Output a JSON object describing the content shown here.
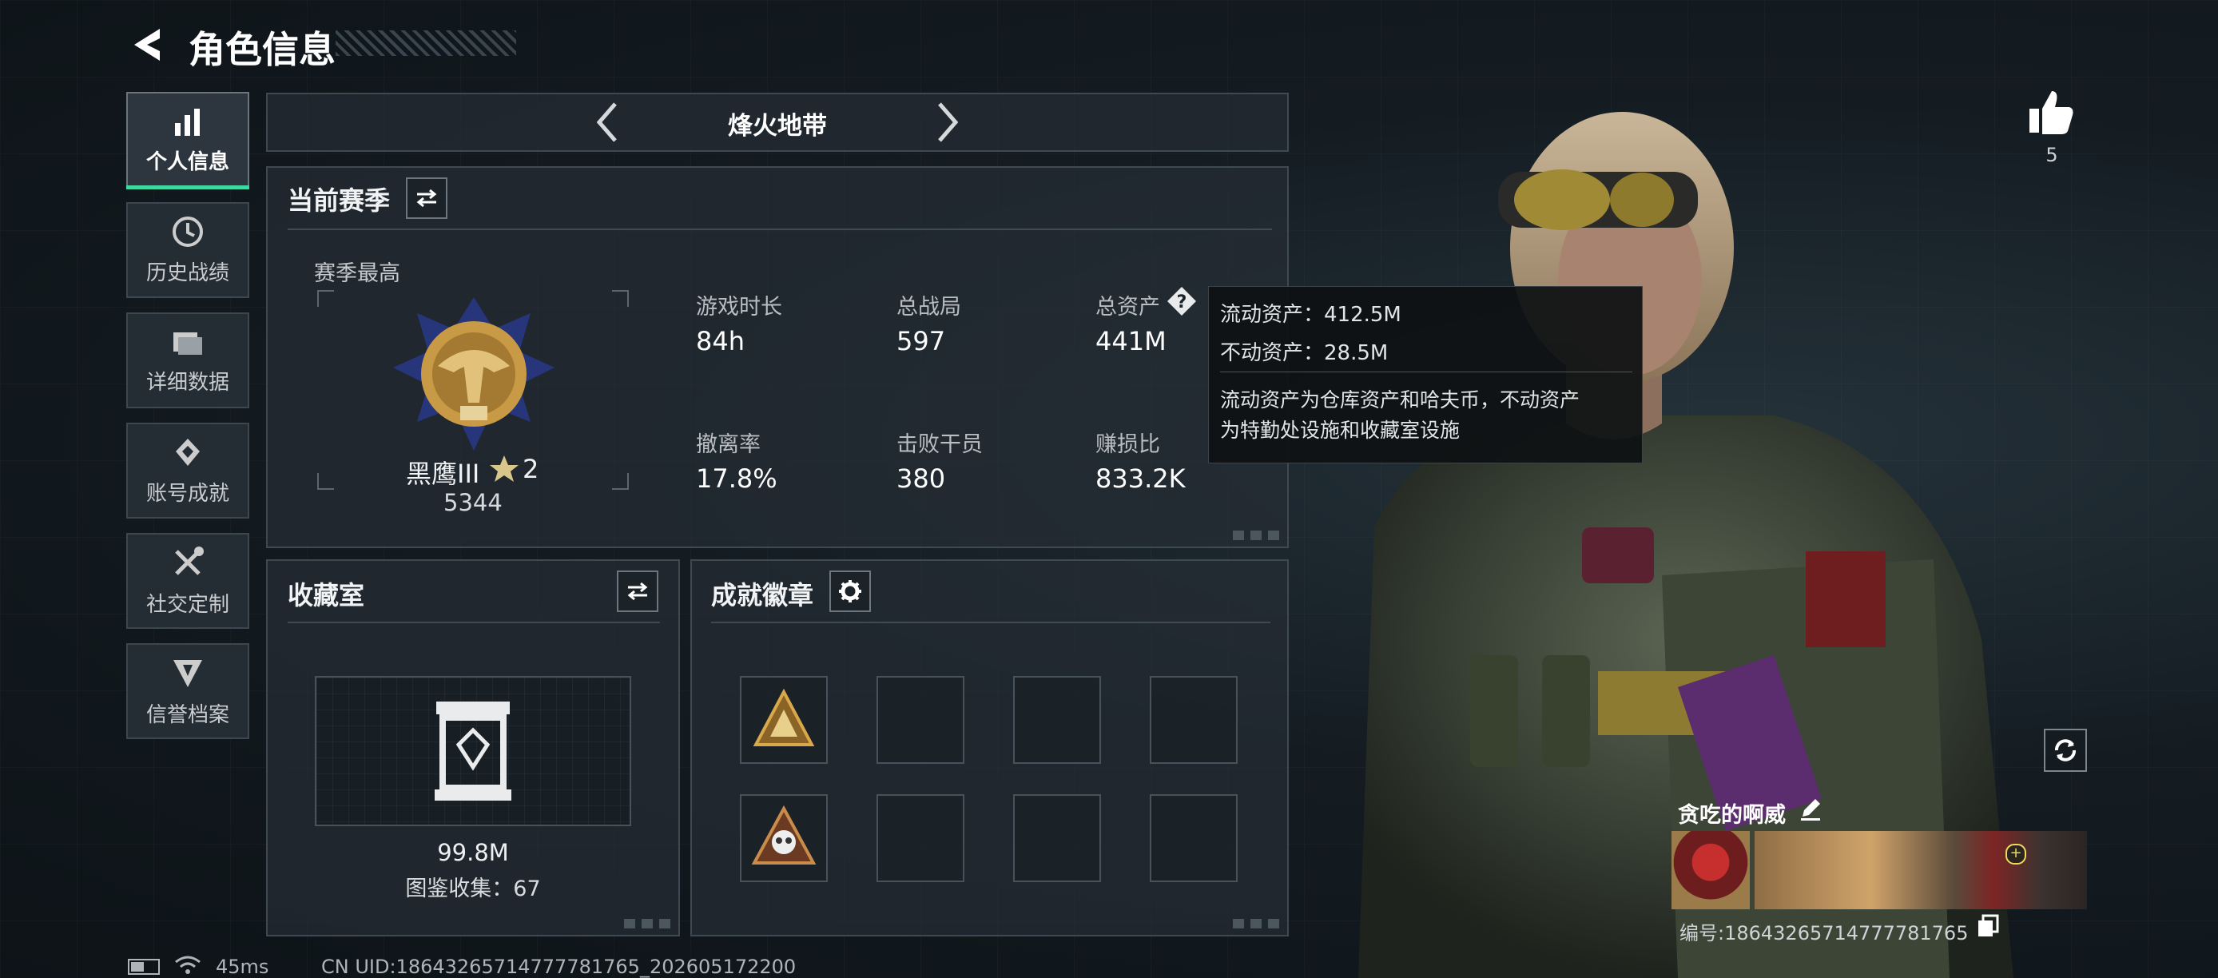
{
  "header": {
    "title": "角色信息"
  },
  "sidebar": {
    "items": [
      {
        "label": "个人信息",
        "icon": "bar-chart-icon",
        "active": true
      },
      {
        "label": "历史战绩",
        "icon": "history-clock-icon"
      },
      {
        "label": "详细数据",
        "icon": "folder-icon"
      },
      {
        "label": "账号成就",
        "icon": "achievement-icon"
      },
      {
        "label": "社交定制",
        "icon": "tools-icon"
      },
      {
        "label": "信誉档案",
        "icon": "reputation-icon"
      }
    ]
  },
  "mode": {
    "name": "烽火地带"
  },
  "season": {
    "title": "当前赛季",
    "best_label": "赛季最高",
    "rank_name": "黑鹰III",
    "rank_stars": "2",
    "rank_score": "5344",
    "stats": [
      {
        "label": "游戏时长",
        "value": "84h"
      },
      {
        "label": "总战局",
        "value": "597"
      },
      {
        "label": "总资产",
        "value": "441M"
      },
      {
        "label": "撤离率",
        "value": "17.8%"
      },
      {
        "label": "击败干员",
        "value": "380"
      },
      {
        "label": "赚损比",
        "value": "833.2K"
      }
    ]
  },
  "tooltip": {
    "liquid": "流动资产：412.5M",
    "fixed": "不动资产：28.5M",
    "desc_line1": "流动资产为仓库资产和哈夫币，不动资产",
    "desc_line2": "为特勤处设施和收藏室设施"
  },
  "collection": {
    "title": "收藏室",
    "value": "99.8M",
    "catalog": "图鉴收集：67"
  },
  "badges": {
    "title": "成就徽章"
  },
  "profile": {
    "likes": "5",
    "name": "贪吃的啊威",
    "uid": "编号:18643265714777781765"
  },
  "footer": {
    "ping": "45ms",
    "uid": "CN UID:18643265714777781765_202605172200"
  },
  "colors": {
    "accent": "#3fd7a2",
    "gold": "#d9a84a",
    "panel": "#262d34"
  }
}
